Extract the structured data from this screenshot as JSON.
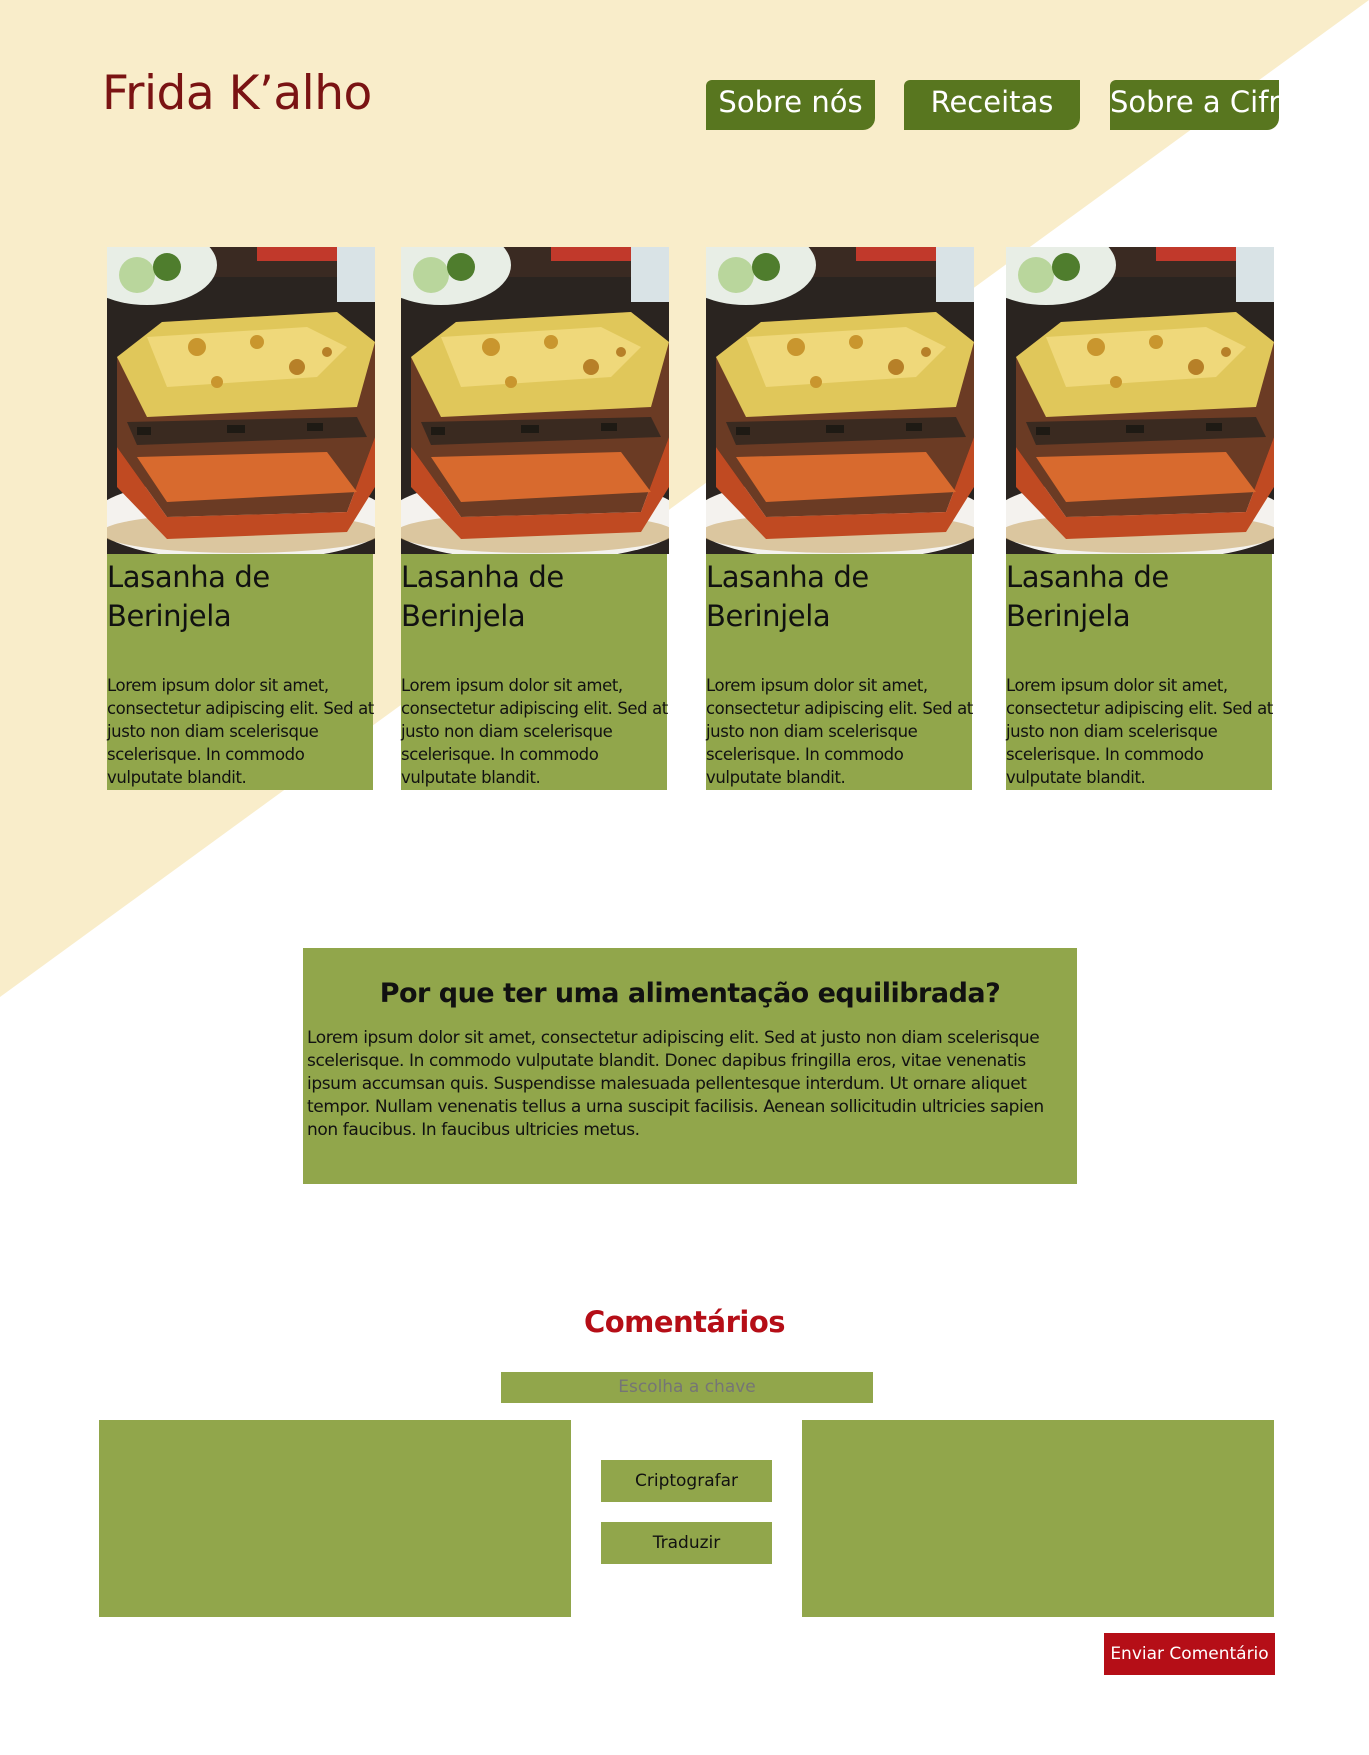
{
  "brand": {
    "logo_text": "Frida K’alho"
  },
  "nav": {
    "items": [
      {
        "label": "Sobre nós"
      },
      {
        "label": "Receitas"
      },
      {
        "label": "Sobre a Cifra"
      }
    ]
  },
  "recipes": [
    {
      "title": "Lasanha de Berinjela",
      "image": "eggplant-lasagna-photo",
      "description": "Lorem ipsum dolor sit amet, consectetur adipiscing elit. Sed at justo non diam scelerisque scelerisque. In commodo vulputate blandit."
    },
    {
      "title": "Lasanha de Berinjela",
      "image": "eggplant-lasagna-photo",
      "description": "Lorem ipsum dolor sit amet, consectetur adipiscing elit. Sed at justo non diam scelerisque scelerisque. In commodo vulputate blandit."
    },
    {
      "title": "Lasanha de Berinjela",
      "image": "eggplant-lasagna-photo",
      "description": "Lorem ipsum dolor sit amet, consectetur adipiscing elit. Sed at justo non diam scelerisque scelerisque. In commodo vulputate blandit."
    },
    {
      "title": "Lasanha de Berinjela",
      "image": "eggplant-lasagna-photo",
      "description": "Lorem ipsum dolor sit amet, consectetur adipiscing elit. Sed at justo non diam scelerisque scelerisque. In commodo vulputate blandit."
    }
  ],
  "info": {
    "title": "Por que ter uma alimentação equilibrada?",
    "text": "Lorem ipsum dolor sit amet, consectetur adipiscing elit. Sed at justo non diam scelerisque scelerisque. In commodo vulputate blandit. Donec dapibus fringilla eros, vitae venenatis ipsum accumsan quis. Suspendisse malesuada pellentesque interdum. Ut ornare aliquet tempor. Nullam venenatis tellus a urna suscipit facilisis. Aenean sollicitudin ultricies sapien non faucibus. In faucibus ultricies metus."
  },
  "comments": {
    "title": "Comentários",
    "key_placeholder": "Escolha a chave",
    "input_value": "",
    "output_value": "",
    "encrypt_label": "Criptografar",
    "translate_label": "Traduzir",
    "send_label": "Enviar Comentário"
  },
  "colors": {
    "background": "#ffffff",
    "diagonal_cream": "#f9edca",
    "nav_green": "#58761f",
    "card_green": "#91a64b",
    "logo_red": "#7a1313",
    "accent_red": "#b50e17"
  }
}
